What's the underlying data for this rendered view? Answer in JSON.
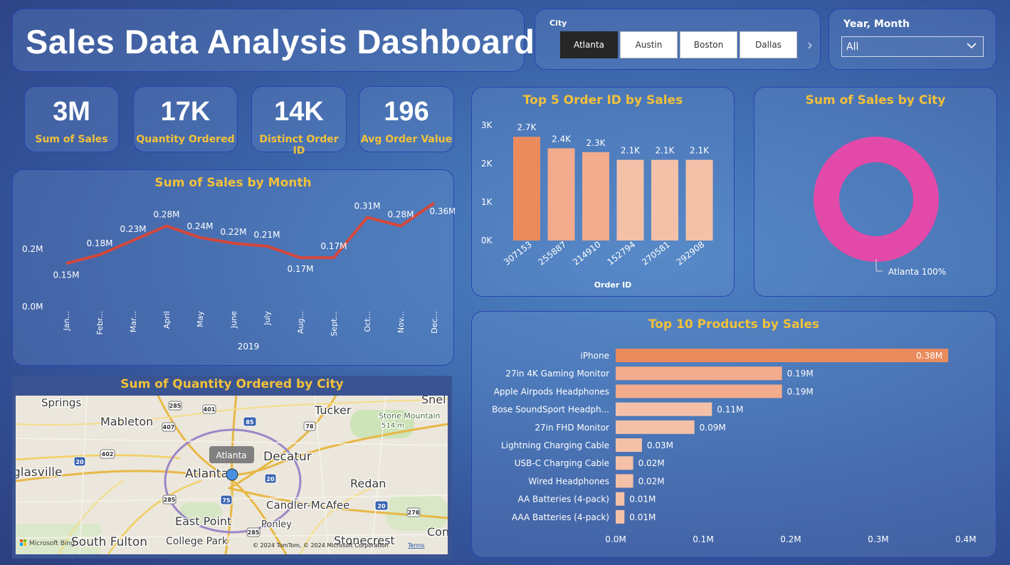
{
  "header": {
    "title": "Sales Data Analysis Dashboard"
  },
  "city_slicer": {
    "label": "City",
    "options": [
      "Atlanta",
      "Austin",
      "Boston",
      "Dallas"
    ],
    "selected": "Atlanta"
  },
  "year_month_slicer": {
    "label": "Year, Month",
    "value": "All"
  },
  "kpis": [
    {
      "value": "3M",
      "label": "Sum of Sales"
    },
    {
      "value": "17K",
      "label": "Quantity Ordered"
    },
    {
      "value": "14K",
      "label": "Distinct Order ID"
    },
    {
      "value": "196",
      "label": "Avg Order Value"
    }
  ],
  "colors": {
    "accent_gold": "#f2c13a",
    "line_red": "#d5473c",
    "bar_top": "#ea8b5e",
    "bar_rest": "#f2ab8c",
    "bar_light": "#f4c1a8",
    "donut_pink": "#e349a8"
  },
  "map": {
    "title": "Sum of Quantity Ordered by City",
    "tooltip": "Atlanta",
    "places": [
      "Springs",
      "Mableton",
      "Tucker",
      "Stone Mountain",
      "Decatur",
      "glasville",
      "Atlanta",
      "Redan",
      "East Point",
      "Candler-McAfee",
      "College Park",
      "South Fulton",
      "Stonecrest",
      "Snel",
      "Con",
      "Ponley"
    ],
    "route_labels": [
      "285",
      "401",
      "85",
      "407",
      "78",
      "402",
      "20",
      "75",
      "278"
    ],
    "elevation": "514 m",
    "attribution": "© 2024 TomTom, © 2024 Microsoft Corporation",
    "terms": "Terms",
    "bing": "Microsoft Bing"
  },
  "chart_data": [
    {
      "type": "line",
      "title": "Sum of Sales by Month",
      "xlabel": "2019",
      "categories": [
        "Jan...",
        "Febr...",
        "Mar...",
        "April",
        "May",
        "June",
        "July",
        "Aug...",
        "Sept...",
        "Oct...",
        "Nov...",
        "Dec..."
      ],
      "values": [
        0.15,
        0.18,
        0.23,
        0.28,
        0.24,
        0.22,
        0.21,
        0.17,
        0.17,
        0.31,
        0.28,
        0.36
      ],
      "data_labels": [
        "0.15M",
        "0.18M",
        "0.23M",
        "0.28M",
        "0.24M",
        "0.22M",
        "0.21M",
        "0.17M",
        "0.17M",
        "0.31M",
        "0.28M",
        "0.36M"
      ],
      "y_ticks": [
        "0.0M",
        "0.2M"
      ],
      "ylim": [
        0,
        0.4
      ]
    },
    {
      "type": "bar",
      "title": "Top 5 Order ID by Sales",
      "xlabel": "Order ID",
      "categories": [
        "307153",
        "255887",
        "214910",
        "152794",
        "270581",
        "292908"
      ],
      "values": [
        2.7,
        2.4,
        2.3,
        2.1,
        2.1,
        2.1
      ],
      "data_labels": [
        "2.7K",
        "2.4K",
        "2.3K",
        "2.1K",
        "2.1K",
        "2.1K"
      ],
      "y_ticks": [
        "0K",
        "1K",
        "2K",
        "3K"
      ],
      "ylim": [
        0,
        3
      ]
    },
    {
      "type": "pie",
      "title": "Sum of Sales by City",
      "categories": [
        "Atlanta"
      ],
      "values": [
        100
      ],
      "legend": "Atlanta 100%"
    },
    {
      "type": "bar",
      "orientation": "horizontal",
      "title": "Top 10 Products by Sales",
      "categories": [
        "iPhone",
        "27in 4K Gaming Monitor",
        "Apple Airpods Headphones",
        "Bose SoundSport Headph...",
        "27in FHD Monitor",
        "Lightning Charging Cable",
        "USB-C Charging Cable",
        "Wired Headphones",
        "AA Batteries (4-pack)",
        "AAA Batteries (4-pack)"
      ],
      "values": [
        0.38,
        0.19,
        0.19,
        0.11,
        0.09,
        0.03,
        0.02,
        0.02,
        0.01,
        0.01
      ],
      "data_labels": [
        "0.38M",
        "0.19M",
        "0.19M",
        "0.11M",
        "0.09M",
        "0.03M",
        "0.02M",
        "0.02M",
        "0.01M",
        "0.01M"
      ],
      "x_ticks": [
        "0.0M",
        "0.1M",
        "0.2M",
        "0.3M",
        "0.4M"
      ],
      "xlim": [
        0,
        0.4
      ]
    }
  ]
}
